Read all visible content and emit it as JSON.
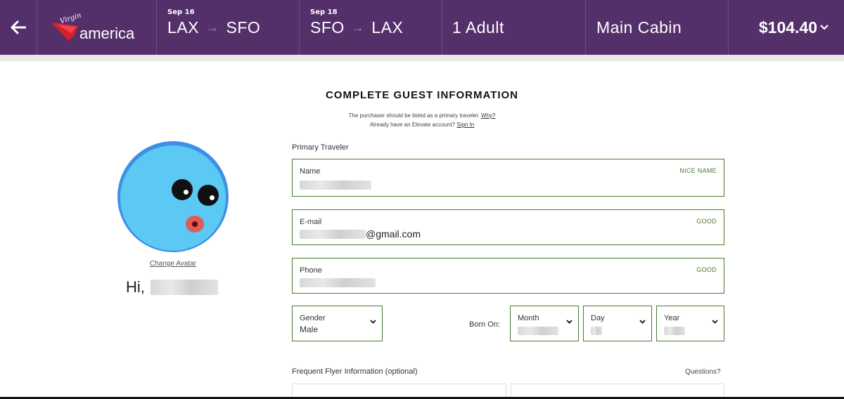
{
  "header": {
    "logo_virgin": "Virgin",
    "logo_america": "america",
    "legs": [
      {
        "date": "Sep 16",
        "from": "LAX",
        "to": "SFO"
      },
      {
        "date": "Sep 18",
        "from": "SFO",
        "to": "LAX"
      }
    ],
    "passengers": "1 Adult",
    "cabin": "Main Cabin",
    "price": "$104.40",
    "icons": {
      "back": "arrow-left-icon",
      "price_toggle": "chevron-down-icon",
      "leg_arrow": "arrow-right-icon"
    }
  },
  "main": {
    "title": "COMPLETE GUEST INFORMATION",
    "purchaser_note": "The purchaser should be listed as a primary traveler.",
    "why_link": "Why?",
    "account_note": "Already have an Elevate account?",
    "signin_link": "Sign In"
  },
  "avatar": {
    "change_label": "Change Avatar",
    "greeting": "Hi,"
  },
  "form": {
    "primary_traveler_label": "Primary Traveler",
    "name": {
      "label": "Name",
      "status": "NICE NAME"
    },
    "email": {
      "label": "E-mail",
      "value_suffix": "@gmail.com",
      "status": "GOOD"
    },
    "phone": {
      "label": "Phone",
      "status": "GOOD"
    },
    "gender": {
      "label": "Gender",
      "value": "Male"
    },
    "born_on_label": "Born On:",
    "month": {
      "label": "Month"
    },
    "day": {
      "label": "Day"
    },
    "year": {
      "label": "Year"
    },
    "frequent_flyer_label": "Frequent Flyer Information (optional)",
    "questions_link": "Questions?"
  },
  "colors": {
    "header_bg": "#54306b",
    "valid_green": "#4a7a2c",
    "brand_red": "#d6202e",
    "avatar_blue": "#5cc9f5"
  }
}
